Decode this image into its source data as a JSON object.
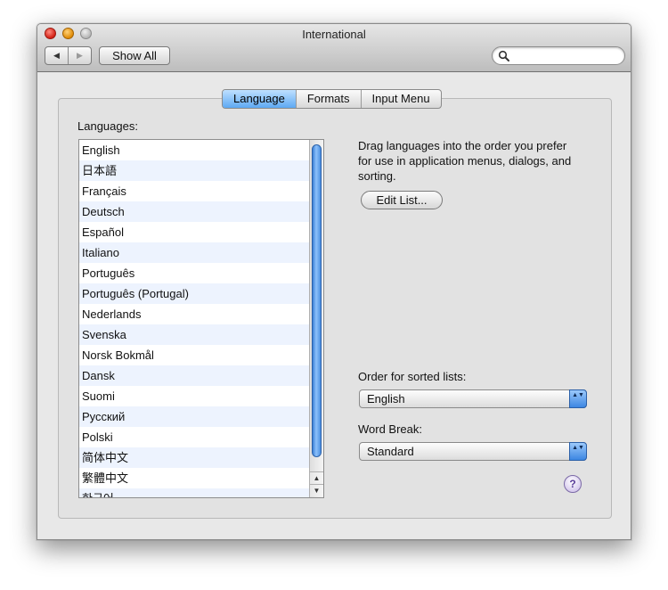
{
  "window": {
    "title": "International"
  },
  "toolbar": {
    "back_icon": "◀",
    "forward_icon": "▶",
    "show_all_label": "Show All",
    "search": {
      "value": "",
      "placeholder": ""
    }
  },
  "tabs": [
    {
      "label": "Language",
      "active": true
    },
    {
      "label": "Formats",
      "active": false
    },
    {
      "label": "Input Menu",
      "active": false
    }
  ],
  "languages": {
    "label": "Languages:",
    "items": [
      "English",
      "日本語",
      "Français",
      "Deutsch",
      "Español",
      "Italiano",
      "Português",
      "Português (Portugal)",
      "Nederlands",
      "Svenska",
      "Norsk Bokmål",
      "Dansk",
      "Suomi",
      "Русский",
      "Polski",
      "简体中文",
      "繁體中文",
      "한국어"
    ],
    "scroll_up_icon": "▲",
    "scroll_down_icon": "▼"
  },
  "instructions": "Drag languages into the order you prefer for use in application menus, dialogs, and sorting.",
  "edit_list_label": "Edit List...",
  "sorted_lists": {
    "label": "Order for sorted lists:",
    "value": "English"
  },
  "word_break": {
    "label": "Word Break:",
    "value": "Standard"
  },
  "select_arrows": "▲▼",
  "help_label": "?",
  "colors": {
    "tab_active": "#5ea9f3",
    "scroll_thumb": "#4b8ee0",
    "row_alt": "#edf3fe"
  }
}
